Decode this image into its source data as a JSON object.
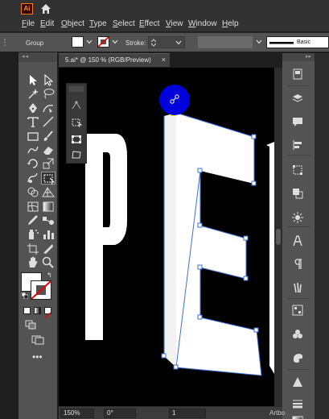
{
  "app": {
    "logo_text": "Ai",
    "icons": [
      "home-icon"
    ]
  },
  "menu": {
    "items": [
      "File",
      "Edit",
      "Object",
      "Type",
      "Select",
      "Effect",
      "View",
      "Window",
      "Help"
    ]
  },
  "control_bar": {
    "selection_label": "Group",
    "stroke_label": "Stroke:",
    "brush_label": "Basic",
    "fill_color": "#ffffff",
    "stroke_state": "none"
  },
  "document": {
    "tab_title": "5.ai* @ 150 % (RGB/Preview)",
    "close_glyph": "×"
  },
  "canvas": {
    "background": "#000000",
    "letters": [
      "P",
      "E",
      "O"
    ],
    "selection_color": "#3b6fd6",
    "handle_color": "#0000dd",
    "handle_icon": "anchor-icon"
  },
  "toolbar": {
    "grip_text": "◂◂",
    "more_tools_glyph": "•••",
    "swap_glyph": "↰",
    "tools": [
      "selection-tool-icon",
      "direct-selection-tool-icon",
      "magic-wand-tool-icon",
      "lasso-tool-icon",
      "pen-tool-icon",
      "curvature-tool-icon",
      "type-tool-icon",
      "line-tool-icon",
      "rectangle-tool-icon",
      "paintbrush-tool-icon",
      "shaper-tool-icon",
      "eraser-tool-icon",
      "rotate-tool-icon",
      "scale-tool-icon",
      "warp-tool-icon",
      "free-transform-tool-icon",
      "shape-builder-tool-icon",
      "perspective-grid-tool-icon",
      "mesh-tool-icon",
      "gradient-tool-icon",
      "eyedropper-tool-icon",
      "blend-tool-icon",
      "symbol-sprayer-tool-icon",
      "graph-tool-icon",
      "artboard-tool-icon",
      "slice-tool-icon",
      "hand-tool-icon",
      "zoom-tool-icon"
    ]
  },
  "right_dock": {
    "grip_text": "▸▸",
    "panels": [
      "properties-icon",
      "layers-icon",
      "comments-icon",
      "align-icon",
      "transform-icon",
      "pathfinder-icon",
      "appearance-icon",
      "character-icon",
      "paragraph-icon",
      "libraries-icon",
      "graphic-styles-icon",
      "symbols-icon",
      "color-icon",
      "color-guide-icon",
      "stroke-icon",
      "gradient-icon"
    ]
  },
  "status_bar": {
    "zoom": "150%",
    "rotation": "0°",
    "artboard_number": "1",
    "artboard_label": "Artbo"
  }
}
